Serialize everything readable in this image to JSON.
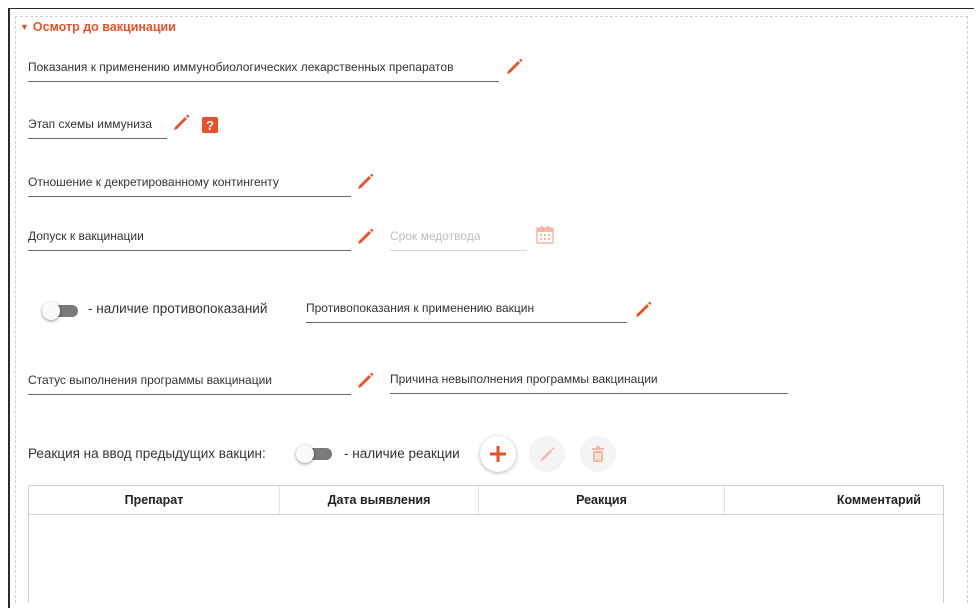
{
  "section": {
    "title": "Осмотр до вакцинации",
    "arrow": "▼"
  },
  "fields": {
    "indications": "Показания к применению иммунобиологических лекарственных препаратов",
    "stage": "Этап схемы иммуниза",
    "decreed": "Отношение к декретированному контингенту",
    "admission": "Допуск к вакцинации",
    "exemption_term_placeholder": "Срок медотвода",
    "contraindications": "Противопоказания к применению вакцин",
    "program_status": "Статус выполнения программы вакцинации",
    "noncompletion_reason": "Причина невыполнения программы вакцинации"
  },
  "toggles": {
    "contraindications_label": "- наличие противопоказаний",
    "reaction_label": "- наличие реакции"
  },
  "reaction": {
    "label": "Реакция на ввод предыдущих вакцин:"
  },
  "table": {
    "columns": [
      "Препарат",
      "Дата выявления",
      "Реакция",
      "Комментарий"
    ],
    "rows": []
  },
  "colors": {
    "accent": "#e8502a",
    "disabled_icon": "#f3b7a6",
    "toggle_track": "#7a7a7a"
  },
  "icons": {
    "edit": "pencil-icon",
    "help": "question-icon",
    "calendar": "calendar-icon",
    "add": "plus-icon",
    "delete": "trash-icon"
  }
}
